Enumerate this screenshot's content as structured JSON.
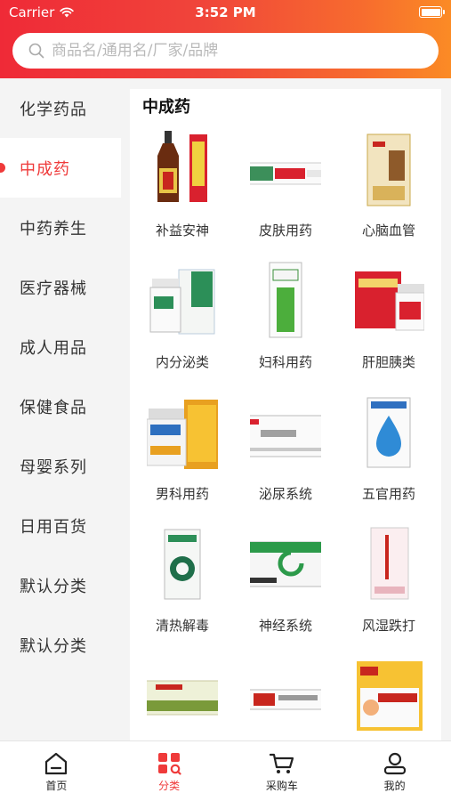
{
  "status": {
    "carrier": "Carrier",
    "time": "3:52 PM"
  },
  "search": {
    "placeholder": "商品名/通用名/厂家/品牌"
  },
  "sidebar": {
    "items": [
      {
        "label": "化学药品"
      },
      {
        "label": "中成药",
        "active": true
      },
      {
        "label": "中药养生"
      },
      {
        "label": "医疗器械"
      },
      {
        "label": "成人用品"
      },
      {
        "label": "保健食品"
      },
      {
        "label": "母婴系列"
      },
      {
        "label": "日用百货"
      },
      {
        "label": "默认分类"
      },
      {
        "label": "默认分类"
      }
    ]
  },
  "content": {
    "title": "中成药",
    "items": [
      {
        "label": "补益安神",
        "icon": "tonic-bottle-image"
      },
      {
        "label": "皮肤用药",
        "icon": "ointment-box-image"
      },
      {
        "label": "心脑血管",
        "icon": "herbal-box-image"
      },
      {
        "label": "内分泌类",
        "icon": "pill-bottle-image"
      },
      {
        "label": "妇科用药",
        "icon": "gynecology-box-image"
      },
      {
        "label": "肝胆胰类",
        "icon": "liver-medicine-image"
      },
      {
        "label": "男科用药",
        "icon": "mens-health-image"
      },
      {
        "label": "泌尿系统",
        "icon": "capsule-box-image"
      },
      {
        "label": "五官用药",
        "icon": "eye-drops-image"
      },
      {
        "label": "清热解毒",
        "icon": "throat-box-image"
      },
      {
        "label": "神经系统",
        "icon": "nerve-capsule-image"
      },
      {
        "label": "风湿跌打",
        "icon": "rheumatism-box-image"
      },
      {
        "label": "",
        "icon": "oral-liquid-image"
      },
      {
        "label": "",
        "icon": "ointment-tube-image"
      },
      {
        "label": "",
        "icon": "child-patch-image"
      }
    ]
  },
  "tabbar": {
    "tabs": [
      {
        "label": "首页",
        "icon": "home-icon"
      },
      {
        "label": "分类",
        "icon": "category-icon",
        "active": true
      },
      {
        "label": "采购车",
        "icon": "cart-icon"
      },
      {
        "label": "我的",
        "icon": "profile-icon"
      }
    ]
  },
  "colors": {
    "accent": "#ef3a3a",
    "header_start": "#ef2a37",
    "header_end": "#fb8b25"
  }
}
